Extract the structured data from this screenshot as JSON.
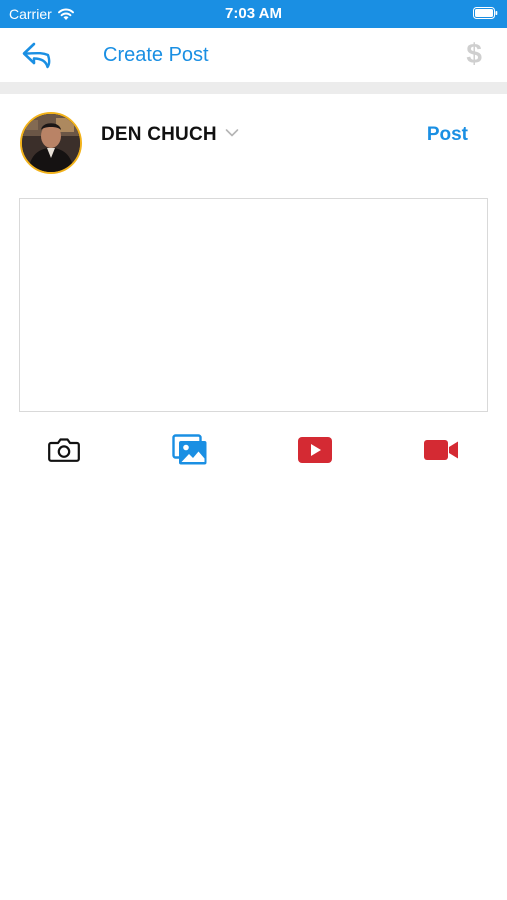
{
  "status_bar": {
    "carrier": "Carrier",
    "time": "7:03 AM"
  },
  "nav": {
    "title": "Create Post",
    "dollar_symbol": "$"
  },
  "author": {
    "name": "DEN CHUCH"
  },
  "actions": {
    "post_label": "Post"
  },
  "composer": {
    "text": "",
    "placeholder": ""
  },
  "media_toolbar": {
    "items": [
      "camera-icon",
      "photo-gallery-icon",
      "youtube-icon",
      "video-camera-icon"
    ]
  },
  "colors": {
    "accent": "#1a8fe3",
    "avatar_ring": "#f2b21b",
    "media_red": "#d42a33",
    "disabled": "#cfcfcf"
  }
}
